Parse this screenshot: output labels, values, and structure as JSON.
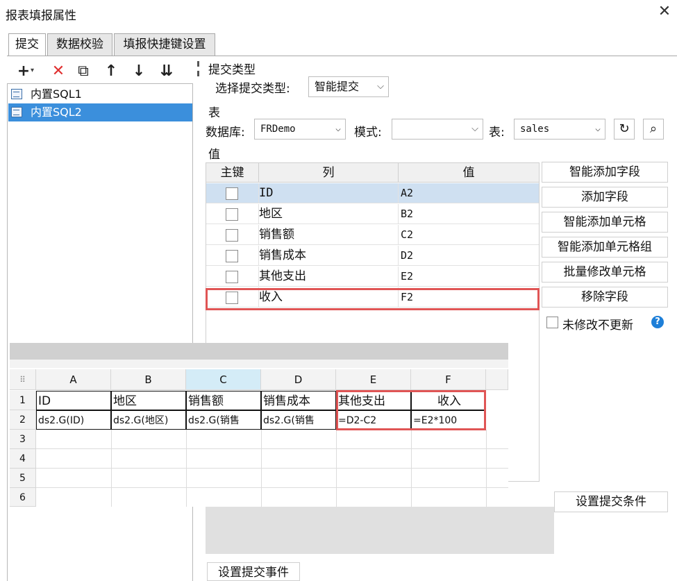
{
  "window": {
    "title": "报表填报属性",
    "close_icon": "close-icon"
  },
  "tabs": [
    {
      "label": "提交"
    },
    {
      "label": "数据校验"
    },
    {
      "label": "填报快捷键设置"
    }
  ],
  "toolbar": {
    "add": "+",
    "add_arrow": "▾",
    "delete": "✕",
    "copy": "⧉",
    "up": "↑",
    "down": "↓",
    "sort": "⇊"
  },
  "sql_list": [
    {
      "label": "内置SQL1"
    },
    {
      "label": "内置SQL2"
    }
  ],
  "submit_type": {
    "section": "提交类型",
    "label": "选择提交类型:",
    "value": "智能提交"
  },
  "table_section": {
    "section": "表",
    "db_label": "数据库:",
    "db_value": "FRDemo",
    "schema_label": "模式:",
    "schema_value": "",
    "table_label": "表:",
    "table_value": "sales",
    "refresh_icon": "↻",
    "preview_icon": "⌕"
  },
  "values_section": {
    "section": "值",
    "headers": [
      "主键",
      "列",
      "值"
    ],
    "rows": [
      {
        "col": "ID",
        "val": "A2"
      },
      {
        "col": "地区",
        "val": "B2"
      },
      {
        "col": "销售额",
        "val": "C2"
      },
      {
        "col": "销售成本",
        "val": "D2"
      },
      {
        "col": "其他支出",
        "val": "E2"
      },
      {
        "col": "收入",
        "val": "F2"
      }
    ]
  },
  "side_buttons": [
    "智能添加字段",
    "添加字段",
    "智能添加单元格",
    "智能添加单元格组",
    "批量修改单元格",
    "移除字段"
  ],
  "no_update_unmodified": "未修改不更新",
  "help": "?",
  "set_condition": "设置提交条件",
  "set_event": "设置提交事件",
  "sheet": {
    "corner": "⠿",
    "columns": [
      "A",
      "B",
      "C",
      "D",
      "E",
      "F"
    ],
    "rows": [
      "1",
      "2",
      "3",
      "4",
      "5",
      "6"
    ],
    "row1": [
      "ID",
      "地区",
      "销售额",
      "销售成本",
      "其他支出",
      "收入"
    ],
    "row2": [
      "ds2.G(ID)",
      "ds2.G(地区)",
      "ds2.G(销售",
      "ds2.G(销售",
      "=D2-C2",
      "=E2*100"
    ]
  }
}
